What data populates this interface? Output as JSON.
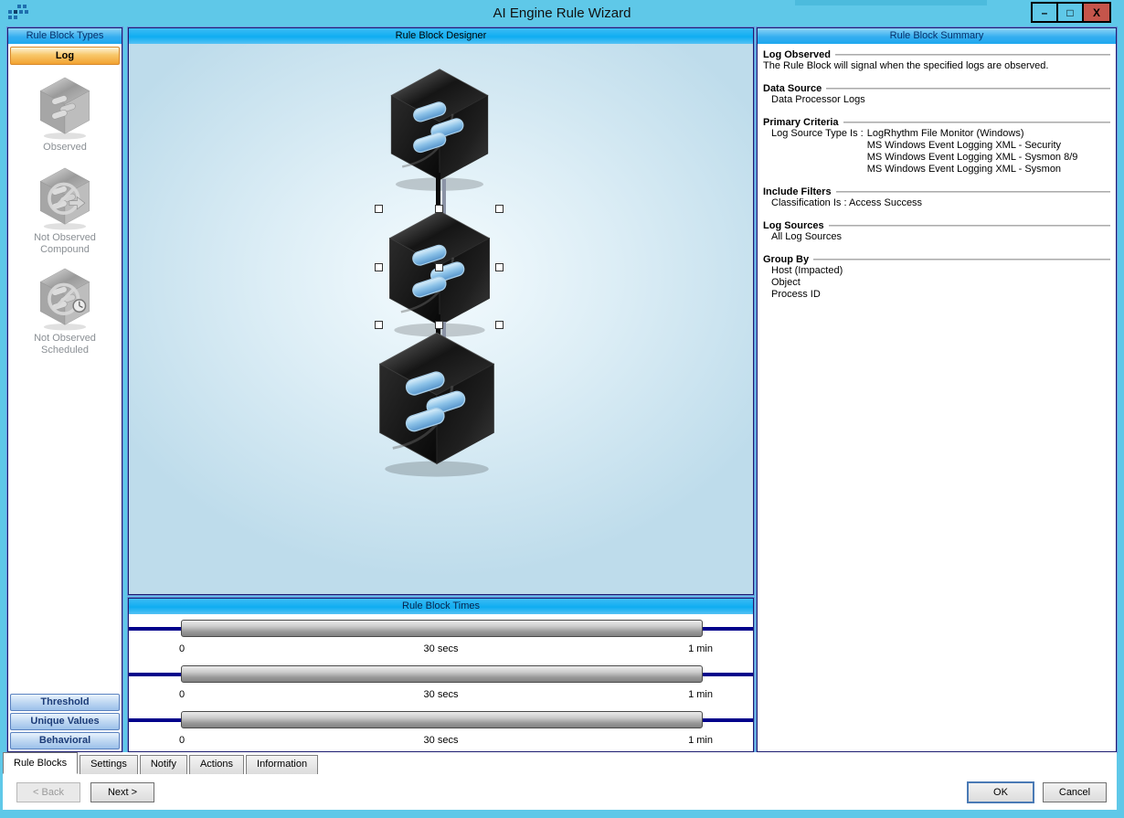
{
  "titlebar": {
    "title": "AI Engine Rule Wizard",
    "minimize": "–",
    "maximize": "□",
    "close": "X"
  },
  "colors": {
    "frame_teal": "#5fc8e8",
    "close_red": "#c5554b",
    "accent_orange": "#f2a232",
    "header_blue": "#1ea9ef",
    "track_navy": "#00008b"
  },
  "sidebar": {
    "header": "Rule Block Types",
    "log_button": "Log",
    "items": [
      {
        "icon": "observed-cube-icon",
        "line1": "Observed",
        "line2": ""
      },
      {
        "icon": "not-observed-compound-cube-icon",
        "line1": "Not Observed",
        "line2": "Compound"
      },
      {
        "icon": "not-observed-scheduled-cube-icon",
        "line1": "Not Observed",
        "line2": "Scheduled"
      }
    ],
    "type_buttons": {
      "threshold": "Threshold",
      "unique_values": "Unique Values",
      "behavioral": "Behavioral"
    }
  },
  "designer": {
    "header": "Rule Block Designer"
  },
  "times": {
    "header": "Rule Block Times",
    "sliders": [
      {
        "min": "0",
        "mid": "30 secs",
        "max": "1 min"
      },
      {
        "min": "0",
        "mid": "30 secs",
        "max": "1 min"
      },
      {
        "min": "0",
        "mid": "30 secs",
        "max": "1 min"
      }
    ]
  },
  "summary": {
    "header": "Rule Block Summary",
    "sections": [
      {
        "title": "Log Observed",
        "line1": "The Rule Block will signal when the specified logs are observed."
      },
      {
        "title": "Data Source",
        "line1": "Data Processor Logs"
      },
      {
        "title": "Primary Criteria",
        "label": "Log Source Type Is :",
        "value1": "LogRhythm File Monitor (Windows)",
        "value2": "MS Windows Event Logging XML - Security",
        "value3": "MS Windows Event Logging XML - Sysmon 8/9",
        "value4": "MS Windows Event Logging XML - Sysmon"
      },
      {
        "title": "Include Filters",
        "line1": "Classification Is : Access Success"
      },
      {
        "title": "Log Sources",
        "line1": "All Log Sources"
      },
      {
        "title": "Group By",
        "line1": "Host (Impacted)",
        "line2": "Object",
        "line3": "Process ID"
      }
    ]
  },
  "tabs": {
    "rule_blocks": "Rule Blocks",
    "settings": "Settings",
    "notify": "Notify",
    "actions": "Actions",
    "information": "Information"
  },
  "footer": {
    "back": "< Back",
    "next": "Next >",
    "ok": "OK",
    "cancel": "Cancel"
  }
}
